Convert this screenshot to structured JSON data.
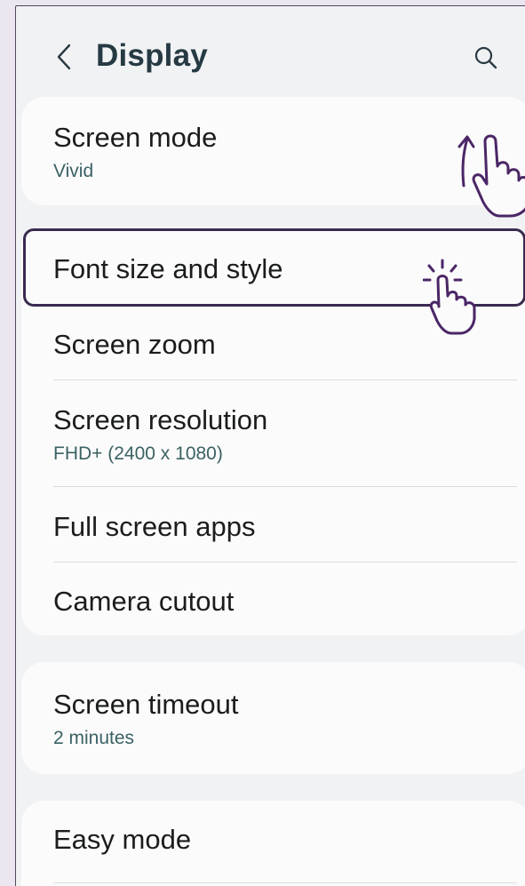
{
  "header": {
    "title": "Display",
    "back_icon": "chevron-left-icon",
    "search_icon": "search-icon"
  },
  "colors": {
    "page_background": "#ece6f1",
    "screen_background": "#f1f2f4",
    "card_background": "#fbfbfb",
    "title_color": "#263a43",
    "subtitle_color": "#3b6164",
    "highlight_border": "#3a2a4f",
    "gesture_color": "#4b2666"
  },
  "cards": [
    {
      "items": [
        {
          "label": "Screen mode",
          "sublabel": "Vivid"
        }
      ]
    },
    {
      "items": [
        {
          "label": "Font size and style",
          "sublabel": ""
        },
        {
          "label": "Screen zoom",
          "sublabel": ""
        },
        {
          "label": "Screen resolution",
          "sublabel": "FHD+ (2400 x 1080)"
        },
        {
          "label": "Full screen apps",
          "sublabel": ""
        },
        {
          "label": "Camera cutout",
          "sublabel": ""
        }
      ]
    },
    {
      "items": [
        {
          "label": "Screen timeout",
          "sublabel": "2 minutes"
        }
      ]
    },
    {
      "items": [
        {
          "label": "Easy mode",
          "sublabel": ""
        }
      ]
    }
  ],
  "gestures": {
    "swipe_up": "swipe-up-hand-icon",
    "tap": "tap-hand-icon"
  }
}
